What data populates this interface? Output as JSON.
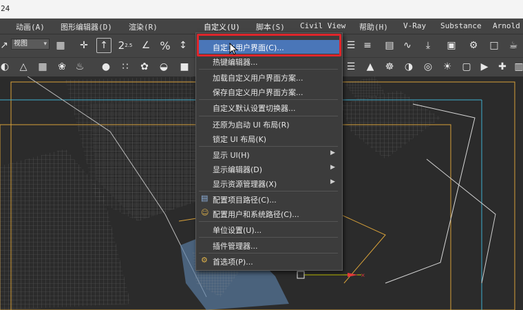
{
  "window": {
    "title_fragment": "24"
  },
  "menubar": {
    "items": [
      {
        "label": "动画(A)"
      },
      {
        "label": "图形编辑器(D)"
      },
      {
        "label": "渲染(R)"
      },
      {
        "label": "自定义(U)"
      },
      {
        "label": "脚本(S)"
      },
      {
        "label": "Civil View"
      },
      {
        "label": "帮助(H)"
      },
      {
        "label": "V-Ray"
      },
      {
        "label": "Substance"
      },
      {
        "label": "Arnold"
      }
    ]
  },
  "toolbar": {
    "view_dropdown": "视图",
    "snap_label": "2.5"
  },
  "custom_menu": {
    "items": [
      {
        "label": "自定义用户界面(C)..."
      },
      {
        "label": "热键编辑器..."
      },
      {
        "label": "加载自定义用户界面方案..."
      },
      {
        "label": "保存自定义用户界面方案..."
      },
      {
        "label": "自定义默认设置切换器..."
      },
      {
        "label": "还原为启动 UI 布局(R)"
      },
      {
        "label": "锁定 UI 布局(K)"
      },
      {
        "label": "显示 UI(H)"
      },
      {
        "label": "显示编辑器(D)"
      },
      {
        "label": "显示资源管理器(X)"
      },
      {
        "label": "配置项目路径(C)..."
      },
      {
        "label": "配置用户和系统路径(C)..."
      },
      {
        "label": "单位设置(U)..."
      },
      {
        "label": "插件管理器..."
      },
      {
        "label": "首选项(P)..."
      }
    ]
  },
  "colors": {
    "highlight": "#4a76b8",
    "callout": "#e0262b",
    "menubar": "#444444"
  }
}
